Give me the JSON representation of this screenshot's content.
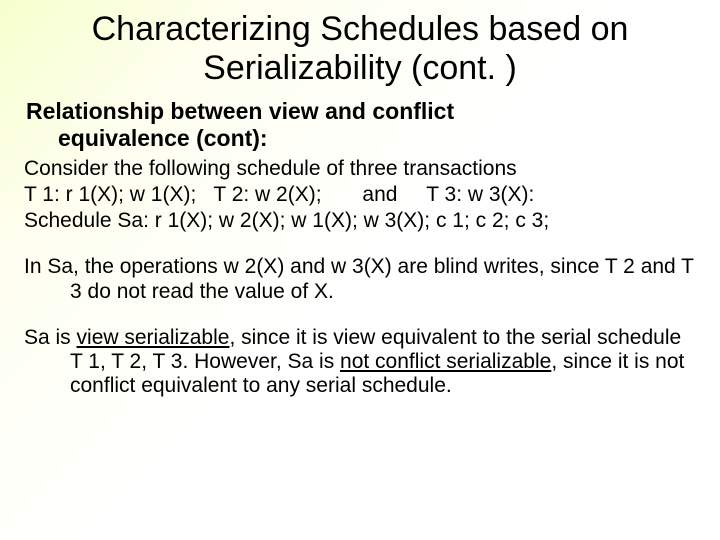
{
  "title": "Characterizing Schedules based on Serializability (cont. )",
  "subhead_l1": "Relationship between view and conflict",
  "subhead_l2": "equivalence (cont):",
  "p_consider": "Consider the following schedule of three transactions",
  "p_tx": "T 1: r 1(X); w 1(X);   T 2: w 2(X);       and     T 3: w 3(X):",
  "p_sa": "Schedule Sa: r 1(X); w 2(X); w 1(X); w 3(X); c 1; c 2; c 3;",
  "p_blind_pre": "In Sa, the operations w 2(X) and w 3(X) are blind writes, since T 2 and T 3 do not read the value of X.",
  "p_final_a": "Sa is ",
  "p_final_vs": "view serializable",
  "p_final_b": ", since it is view equivalent to the serial schedule T 1, T 2, T 3. However, Sa is ",
  "p_final_not": "not conflict serializable",
  "p_final_c": ", since it is not conflict equivalent to any serial schedule."
}
